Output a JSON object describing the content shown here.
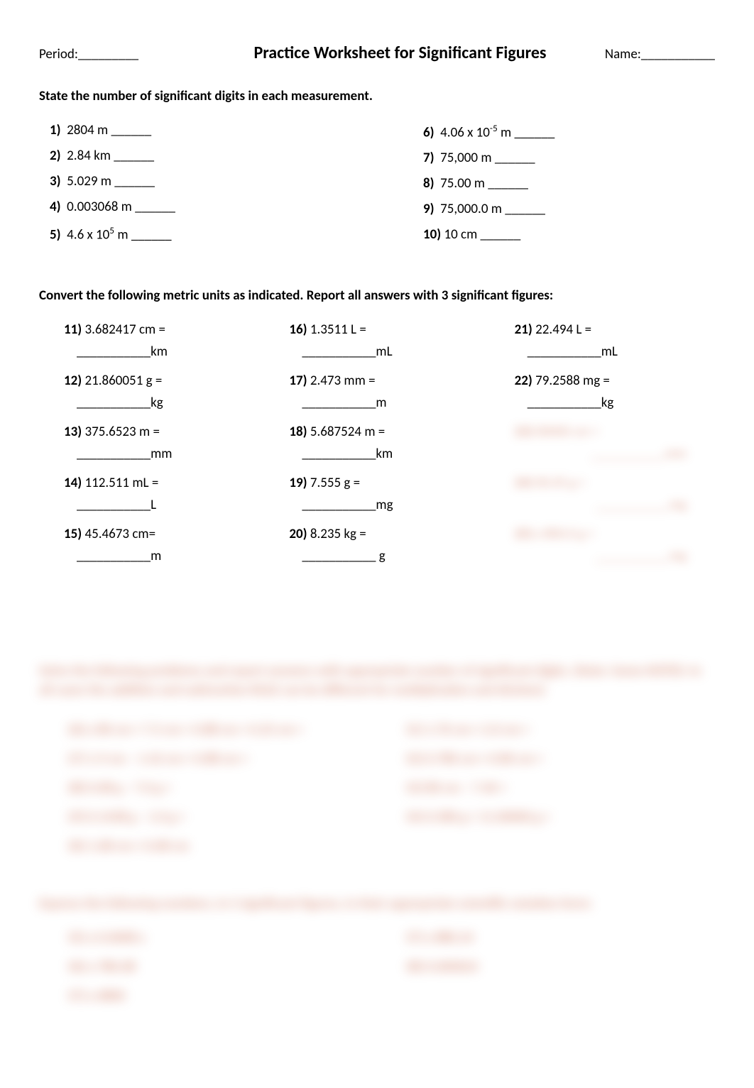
{
  "header": {
    "period_label": "Period:_________",
    "title": "Practice Worksheet for Significant Figures",
    "name_label": "Name:___________"
  },
  "section1": {
    "instruction": "State the number of significant digits in each measurement.",
    "left": [
      {
        "num": "1)",
        "text": "2804 m ______"
      },
      {
        "num": "2)",
        "text": "2.84 km ______"
      },
      {
        "num": "3)",
        "text": "5.029 m ______"
      },
      {
        "num": "4)",
        "text": "0.003068 m ______"
      },
      {
        "num": "5)",
        "text": "4.6 x 10",
        "sup": "5",
        "tail": " m ______"
      }
    ],
    "right": [
      {
        "num": "6)",
        "text": "4.06 x 10",
        "sup": "-5",
        "tail": " m ______"
      },
      {
        "num": "7)",
        "text": "75,000 m ______"
      },
      {
        "num": "8)",
        "text": "75.00 m ______"
      },
      {
        "num": "9)",
        "text": "75,000.0 m ______"
      },
      {
        "num": "10)",
        "text": "10 cm ______"
      }
    ]
  },
  "section2": {
    "instruction": "Convert the following metric units as indicated. Report all answers with 3 significant figures:",
    "col1": [
      {
        "num": "11)",
        "q": "3.682417 cm =",
        "unit": "km"
      },
      {
        "num": "12)",
        "q": "21.860051 g =",
        "unit": "kg"
      },
      {
        "num": "13)",
        "q": "375.6523 m =",
        "unit": "mm"
      },
      {
        "num": "14)",
        "q": "112.511 mL =",
        "unit": "L"
      },
      {
        "num": "15)",
        "q": "45.4673 cm=",
        "unit": "m"
      }
    ],
    "col2": [
      {
        "num": "16)",
        "q": "1.3511 L =",
        "unit": "mL"
      },
      {
        "num": "17)",
        "q": "2.473 mm =",
        "unit": "m"
      },
      {
        "num": "18)",
        "q": "5.687524 m =",
        "unit": "km"
      },
      {
        "num": "19)",
        "q": "7.555 g =",
        "unit": "mg"
      },
      {
        "num": "20)",
        "q": "8.235 kg =",
        "unit": " g"
      }
    ],
    "col3": [
      {
        "num": "21)",
        "q": "22.494 L =",
        "unit": "mL"
      },
      {
        "num": "22)",
        "q": "79.2588 mg =",
        "unit": "kg"
      },
      {
        "num": "23)",
        "q": "",
        "unit": ""
      }
    ]
  },
  "blurred": {
    "instruction": "Solve the following problems and report answers with appropriate number of significant digits. (Note: Some NOTES: In all cases the addition and subtraction RULE can be different for multiplication and division)",
    "left": [
      "26) x 80 cm + 7.5 cm + 0.88 cm + 0.25 cm =",
      "27) 1.9 cm – 1.42 cm + 0.88 cm =",
      "28) 0.08 g – 7.0 g =",
      "29) 0.1438 g – 1.0 g =",
      "30) 1.08 cm × 0.08 cm"
    ],
    "right": [
      "31) 1.70 cm × 2.0 cm =",
      "32) 0.780 cm × 0.80 cm =",
      "33) 80 cm – 7.40 =",
      "34) 0.580 g ÷ 11.00000 g ="
    ],
    "instruction2": "Express the following numbers, in 3 significant figures, in their appropriate scientific notation form:",
    "bottom_left": [
      "35) x 0.0008 x",
      "36) x 780.08",
      "37) x 6800"
    ],
    "bottom_right": [
      "37) x 880.24",
      "38) 0.000024"
    ]
  }
}
